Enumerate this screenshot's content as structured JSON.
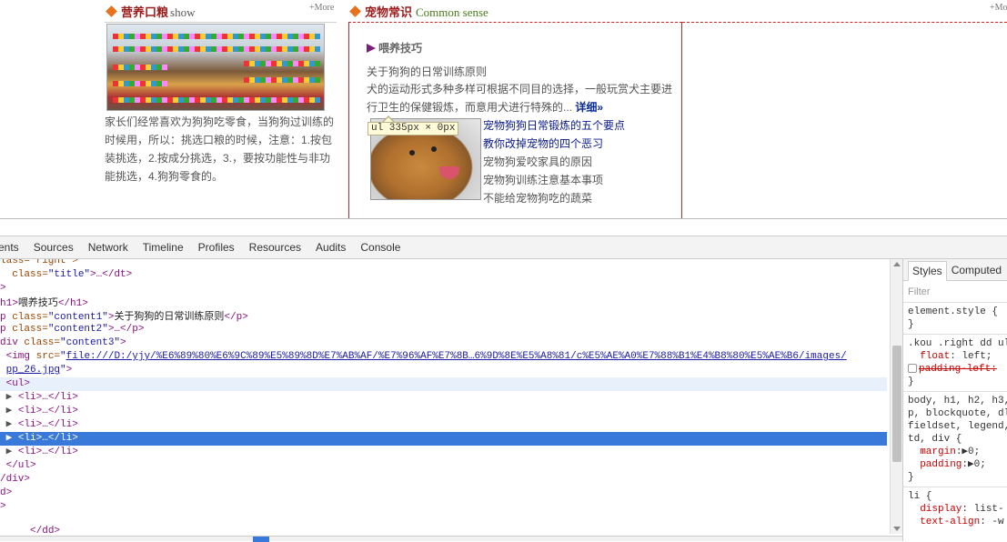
{
  "left_section": {
    "title_cn": "营养口粮",
    "title_en": "show",
    "more": "+More",
    "text": "家长们经常喜欢为狗狗吃零食，当狗狗过训练的时候用，所以：挑选口粮的时候，注意：1.按包装挑选，2.按成分挑选，3.，要按功能性与非功能挑选，4.狗狗零食的。"
  },
  "mid_section": {
    "title_cn": "宠物常识",
    "title_en": "Common sense",
    "more": "+Mo",
    "h1": "喂养技巧",
    "content1": "关于狗狗的日常训练原则",
    "content2": "犬的运动形式多种多样可根据不同目的选择，一般玩赏犬主要进行卫生的保健锻炼，而意用犬进行特殊的...",
    "detail_link": "详细»",
    "tooltip": "ul 335px × 0px",
    "list": [
      "宠物狗狗日常锻炼的五个要点",
      "教你改掉宠物的四个恶习",
      "宠物狗爱咬家具的原因",
      "宠物狗训练注意基本事项",
      "不能给宠物狗吃的蔬菜"
    ]
  },
  "devtools": {
    "tabs": [
      "ments",
      "Sources",
      "Network",
      "Timeline",
      "Profiles",
      "Resources",
      "Audits",
      "Console"
    ],
    "code": {
      "l0": "lass=\"right\">",
      "l1_pre": "class=",
      "l1_val": "\"title\"",
      "l1_post": ">…</dt>",
      "l2": ">",
      "l3_text": "喂养技巧",
      "l4_text": "关于狗狗的日常训练原则",
      "img_url": "file:///D:/yjy/%E6%89%80%E6%9C%89%E5%89%8D%E7%AB%AF/%E7%96%AF%E7%8B…6%9D%8E%E5%A8%81/c%E5%AE%A0%E7%88%B1%E4%B8%80%E5%AE%B6/images/",
      "img_url2": "pp_26.jpg"
    },
    "styles": {
      "tabs": [
        "Styles",
        "Computed"
      ],
      "filter": "Filter",
      "rules": [
        "element.style {\n}",
        ".kou .right dd ul",
        "body, h1, h2, h3,\np, blockquote, dl\nfieldset, legend,\ntd, div {",
        "li {"
      ]
    }
  }
}
